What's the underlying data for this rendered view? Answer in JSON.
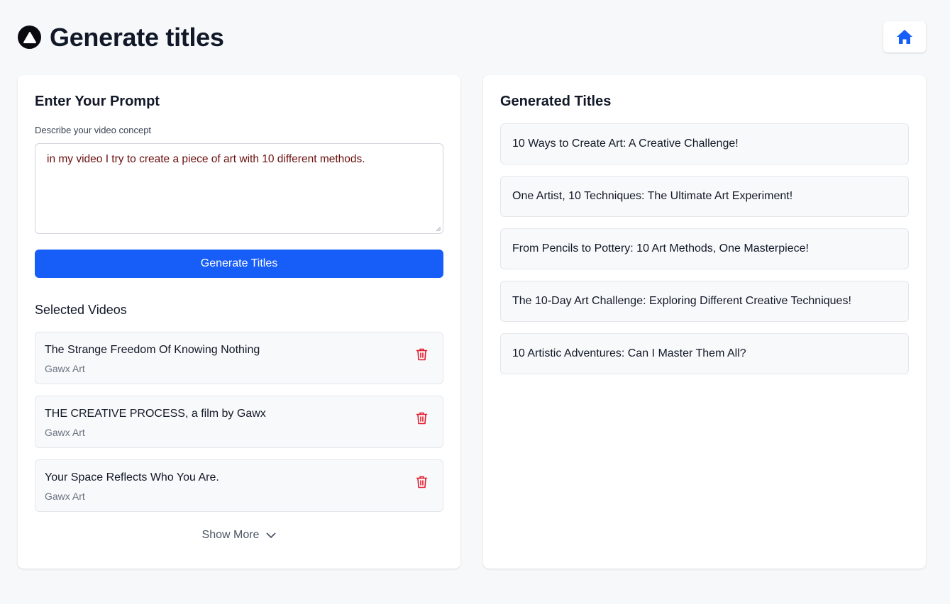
{
  "header": {
    "title": "Generate titles",
    "logo_icon": "triangle-logo-icon",
    "home_icon": "home-icon",
    "accent_color": "#175df8"
  },
  "prompt_card": {
    "title": "Enter Your Prompt",
    "field_label": "Describe your video concept",
    "prompt_value": "in my video I try to create a piece of art with 10 different methods.",
    "generate_label": "Generate Titles"
  },
  "selected_videos": {
    "title": "Selected Videos",
    "items": [
      {
        "title": "The Strange Freedom Of Knowing Nothing",
        "channel": "Gawx Art"
      },
      {
        "title": "THE CREATIVE PROCESS, a film by Gawx",
        "channel": "Gawx Art"
      },
      {
        "title": "Your Space Reflects Who You Are.",
        "channel": "Gawx Art"
      }
    ],
    "delete_icon": "trash-icon",
    "delete_color": "#e11d2e",
    "show_more_label": "Show More",
    "show_more_icon": "chevron-down-icon"
  },
  "generated_card": {
    "title": "Generated Titles",
    "items": [
      "10 Ways to Create Art: A Creative Challenge!",
      "One Artist, 10 Techniques: The Ultimate Art Experiment!",
      "From Pencils to Pottery: 10 Art Methods, One Masterpiece!",
      "The 10-Day Art Challenge: Exploring Different Creative Techniques!",
      "10 Artistic Adventures: Can I Master Them All?"
    ]
  }
}
